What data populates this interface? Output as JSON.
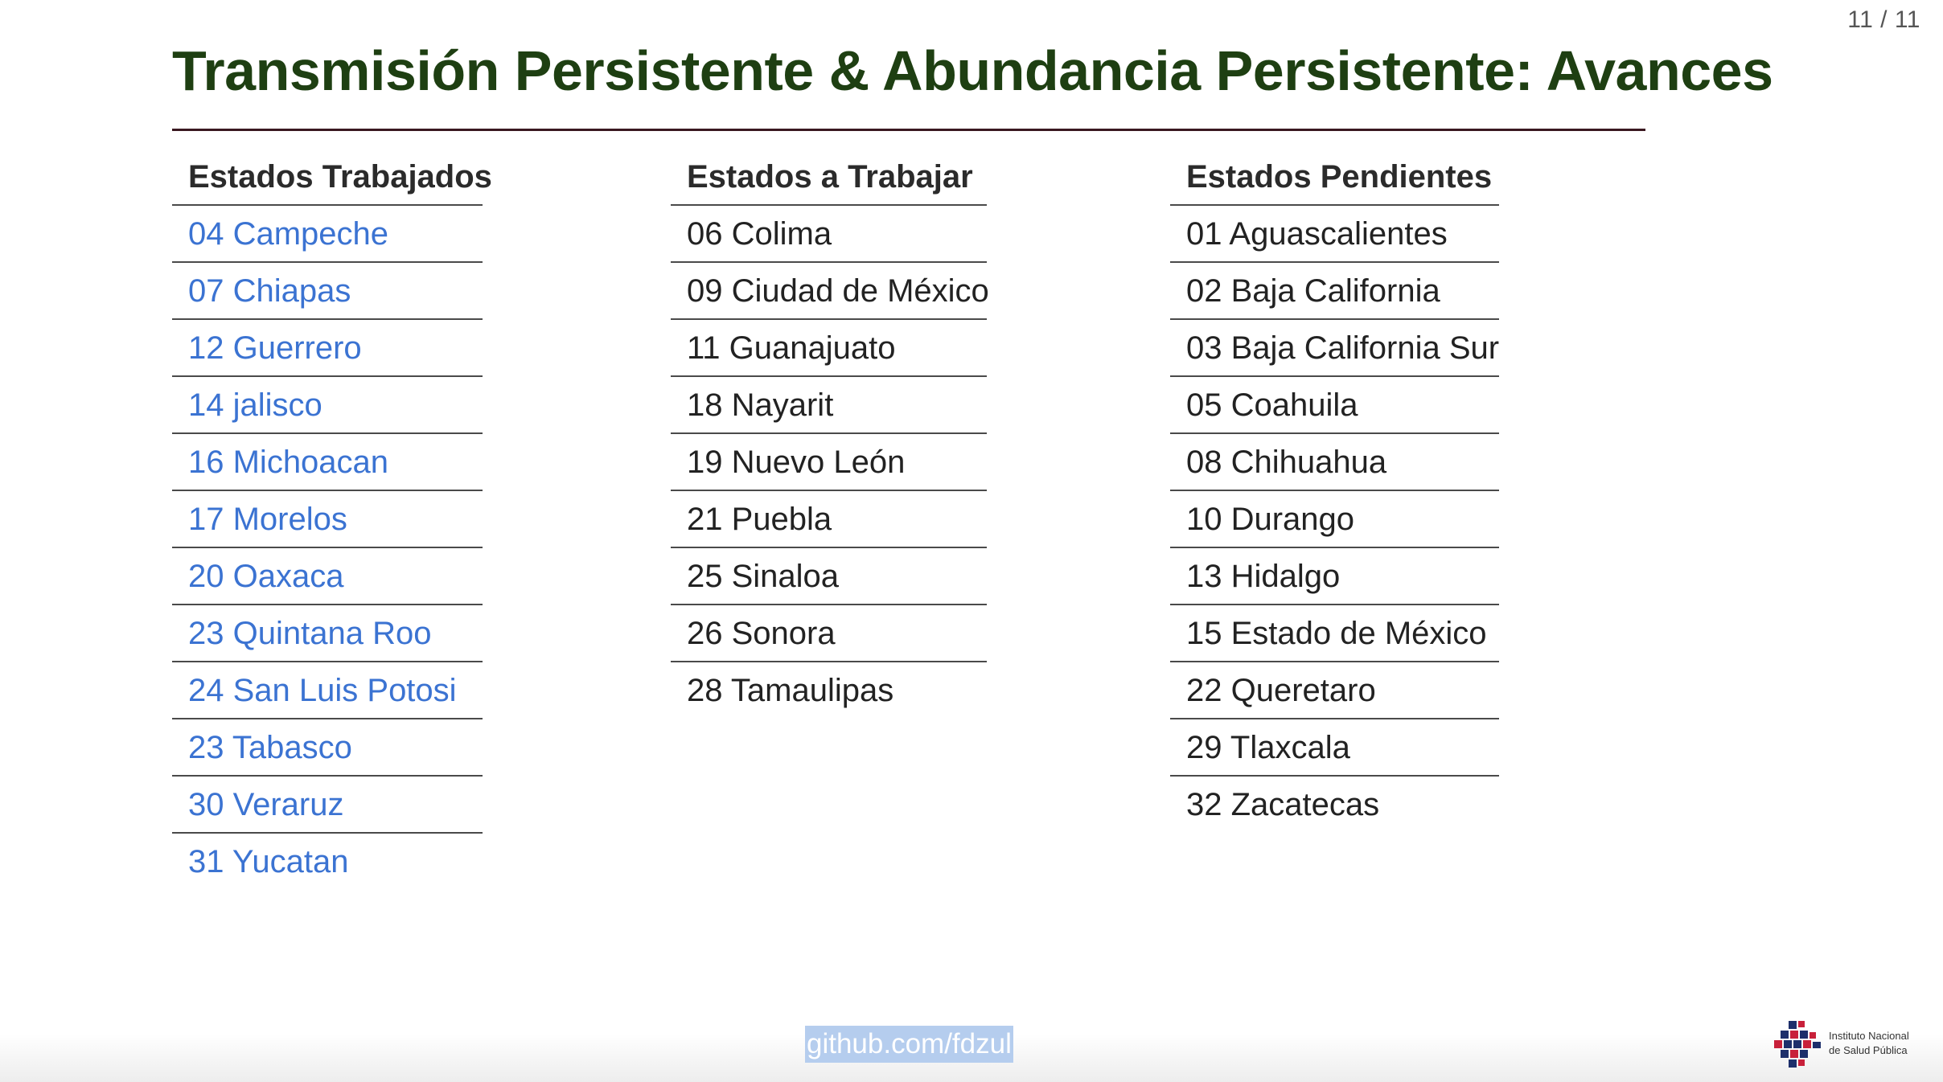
{
  "slide": {
    "number": "11 / 11",
    "title": "Transmisión Persistente & Abundancia Persistente: Avances"
  },
  "columns": {
    "worked": {
      "header": "Estados Trabajados",
      "items": [
        "04 Campeche",
        "07 Chiapas",
        "12 Guerrero",
        "14 jalisco",
        "16 Michoacan",
        "17 Morelos",
        "20 Oaxaca",
        "23 Quintana Roo",
        "24 San Luis Potosi",
        "23 Tabasco",
        "30 Veraruz",
        "31 Yucatan"
      ]
    },
    "todo": {
      "header": "Estados a Trabajar",
      "items": [
        "06 Colima",
        "09 Ciudad de México",
        "11 Guanajuato",
        "18 Nayarit",
        "19 Nuevo León",
        "21 Puebla",
        "25 Sinaloa",
        "26 Sonora",
        "28 Tamaulipas"
      ]
    },
    "pending": {
      "header": "Estados Pendientes",
      "items": [
        "01 Aguascalientes",
        "02 Baja California",
        "03 Baja California Sur",
        "05 Coahuila",
        "08 Chihuahua",
        "10 Durango",
        "13 Hidalgo",
        "15 Estado de México",
        "22 Queretaro",
        "29 Tlaxcala",
        "32 Zacatecas"
      ]
    }
  },
  "footer": {
    "link_text": "github.com/fdzul",
    "logo_line1": "Instituto Nacional",
    "logo_line2": "de Salud Pública",
    "logo_icon": "insp-logo-icon"
  },
  "colors": {
    "title": "#1e3f12",
    "rule": "#3a1820",
    "worked_text": "#3b73d2",
    "link_highlight": "#b5cdee"
  }
}
